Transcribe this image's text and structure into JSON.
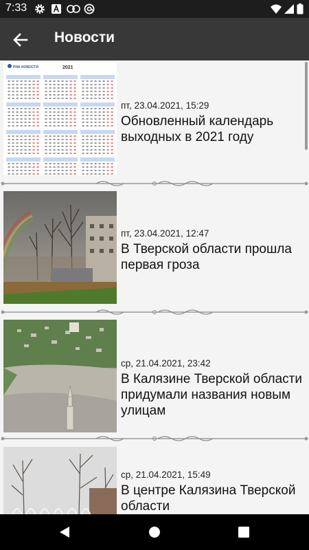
{
  "status_bar": {
    "time": "7:33",
    "icons": [
      "gear-icon",
      "a-square-icon",
      "cc-icon",
      "at-circle-icon",
      "wifi-icon",
      "signal-icon",
      "battery-icon"
    ]
  },
  "app_bar": {
    "title": "Новости",
    "back_icon": "arrow-left-icon"
  },
  "news": [
    {
      "date": "пт, 23.04.2021, 15:29",
      "title": "Обновленный календарь выходных в 2021 году",
      "image": "calendar-thumbnail",
      "image_text": {
        "brand": "РИА НОВОСТИ",
        "year": "2021"
      }
    },
    {
      "date": "пт, 23.04.2021, 12:47",
      "title": "В Тверской области прошла первая гроза",
      "image": "rainbow-thumbnail"
    },
    {
      "date": "ср, 21.04.2021, 23:42",
      "title": "В Калязине Тверской области придумали названия новым улицам",
      "image": "aerial-town-thumbnail"
    },
    {
      "date": "ср, 21.04.2021, 15:49",
      "title": "В центре Калязина Тверской области",
      "image": "fountain-thumbnail"
    }
  ],
  "nav_bar": {
    "icons": [
      "back-triangle-icon",
      "home-circle-icon",
      "recents-square-icon"
    ]
  },
  "colors": {
    "status_bar": "#1d1d1d",
    "app_bar": "#383838",
    "background": "#f4f4f4",
    "nav_bar": "#000000"
  }
}
